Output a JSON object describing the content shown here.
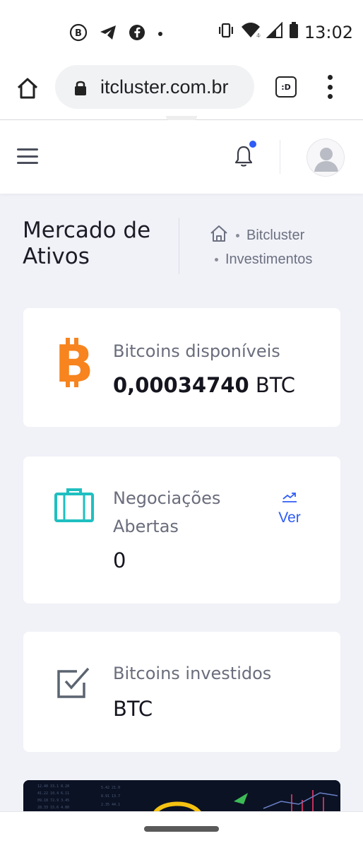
{
  "status_bar": {
    "time": "13:02",
    "icons": [
      "bitcoin-circle-icon",
      "telegram-icon",
      "facebook-icon",
      "dot-icon",
      "vibrate-icon",
      "wifi-icon",
      "signal-icon",
      "battery-icon"
    ]
  },
  "browser": {
    "url": "itcluster.com.br",
    "tab_label": ":D"
  },
  "page": {
    "title": "Mercado de Ativos",
    "breadcrumb": [
      "Bitcluster",
      "Investimentos"
    ]
  },
  "cards": {
    "available": {
      "label": "Bitcoins disponíveis",
      "amount": "0,00034740",
      "unit": "BTC",
      "icon": "bitcoin-icon",
      "icon_color": "#f7841e"
    },
    "open_trades": {
      "label_line1": "Negociações",
      "label_line2": "Abertas",
      "value": "0",
      "link_label": "Ver",
      "icon": "briefcase-icon",
      "icon_color": "#1fbfc0"
    },
    "invested": {
      "label": "Bitcoins investidos",
      "unit": "BTC",
      "icon": "checkbox-icon"
    }
  },
  "colors": {
    "accent": "#2f5cf5",
    "background": "#f1f2f8",
    "notification_dot": "#2f5cf5"
  }
}
